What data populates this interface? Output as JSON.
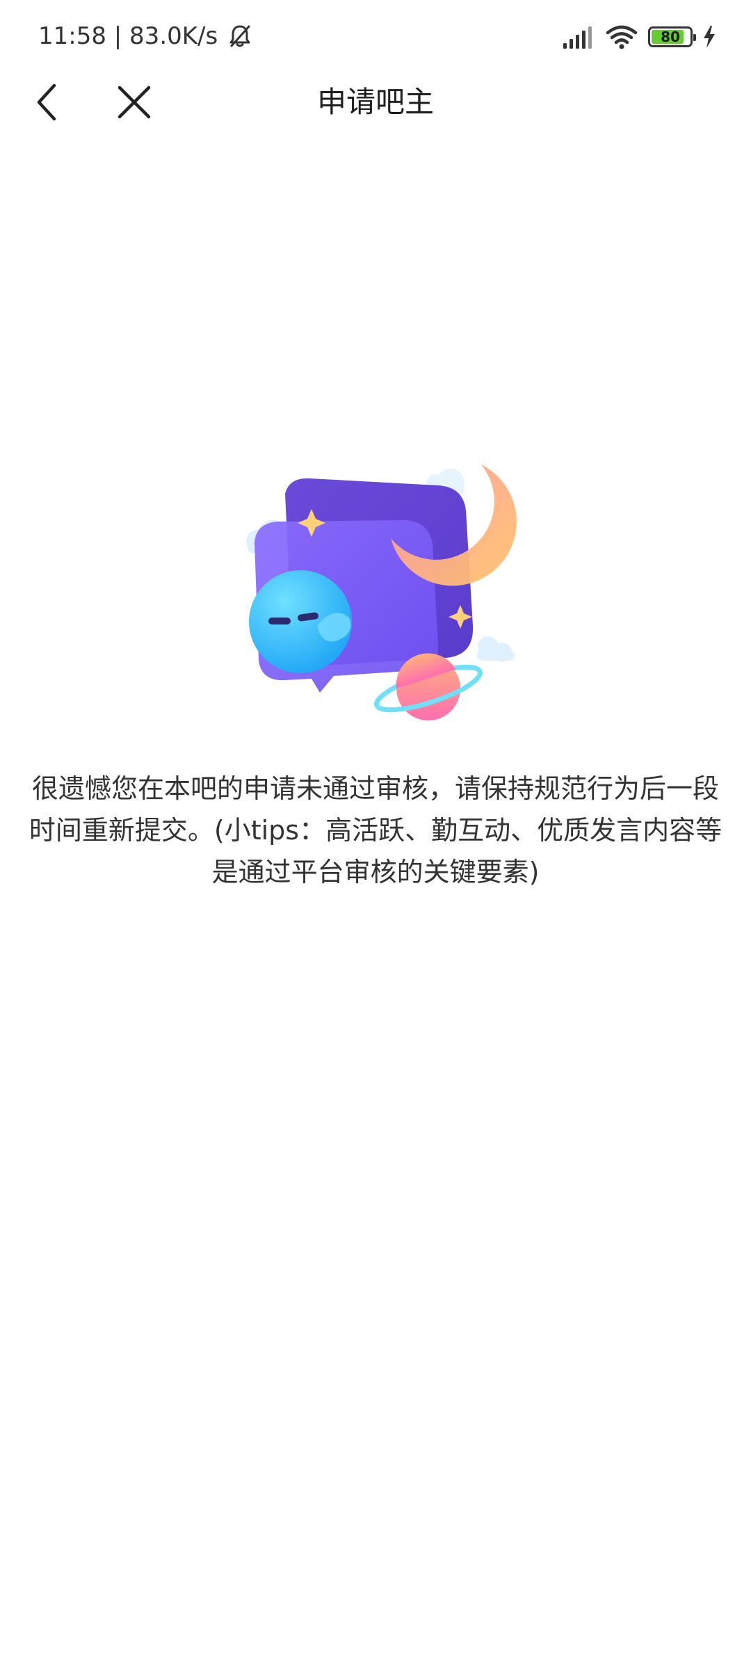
{
  "status_bar": {
    "time_speed": "11:58 | 83.0K/s",
    "battery_level": "80",
    "icons": [
      "bell-off-icon",
      "signal-icon",
      "wifi-icon",
      "battery-icon",
      "charging-icon"
    ]
  },
  "nav": {
    "title": "申请吧主",
    "back_icon": "chevron-left-icon",
    "close_icon": "close-icon"
  },
  "illustration": {
    "icon": "sleeping-chat-bubble-illustration"
  },
  "message": {
    "text": "很遗憾您在本吧的申请未通过审核，请保持规范行为后一段时间重新提交。(小tips：高活跃、勤互动、优质发言内容等是通过平台审核的关键要素)"
  },
  "colors": {
    "background": "#ffffff",
    "text": "#333333",
    "battery_fill": "#66cc33",
    "bubble": "#7b5cf0",
    "moon": "#ffbf6b",
    "face": "#2fb8f7",
    "planet": "#ff86a6"
  }
}
